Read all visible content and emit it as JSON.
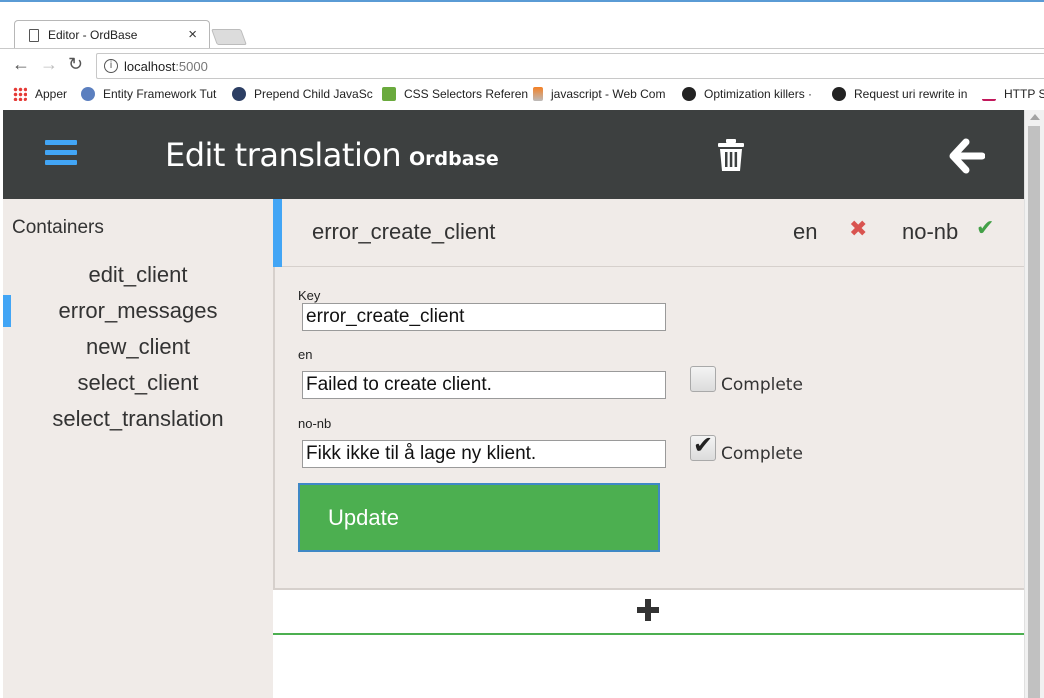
{
  "browser": {
    "tab_title": "Editor - OrdBase",
    "tab_close": "×",
    "url_host": "localhost",
    "url_port": ":5000",
    "bookmarks": [
      {
        "label": "Apper",
        "icon": "apps-grid-icon"
      },
      {
        "label": "Entity Framework Tut",
        "icon": "ef-icon"
      },
      {
        "label": "Prepend Child JavaSc",
        "icon": "x-circle-icon"
      },
      {
        "label": "CSS Selectors Referen",
        "icon": "w3-icon"
      },
      {
        "label": "javascript - Web Com",
        "icon": "stackoverflow-icon"
      },
      {
        "label": "Optimization killers ·",
        "icon": "github-icon"
      },
      {
        "label": "Request uri rewrite in",
        "icon": "github-icon"
      },
      {
        "label": "HTTP S",
        "icon": "http-icon"
      }
    ]
  },
  "header": {
    "title": "Edit translation",
    "subtitle": "Ordbase",
    "colors": {
      "bar": "#3d4040",
      "accent": "#42a5f5"
    }
  },
  "sidebar": {
    "heading": "Containers",
    "items": [
      {
        "label": "edit_client",
        "active": false
      },
      {
        "label": "error_messages",
        "active": true
      },
      {
        "label": "new_client",
        "active": false
      },
      {
        "label": "select_client",
        "active": false
      },
      {
        "label": "select_translation",
        "active": false
      }
    ]
  },
  "entry": {
    "key": "error_create_client",
    "languages": [
      {
        "code": "en",
        "status": "incomplete",
        "status_icon": "x-icon",
        "color": "#d9534f"
      },
      {
        "code": "no-nb",
        "status": "complete",
        "status_icon": "check-icon",
        "color": "#43a047"
      }
    ]
  },
  "form": {
    "key_label": "Key",
    "key_value": "error_create_client",
    "translations": [
      {
        "label": "en",
        "value": "Failed to create client.",
        "complete": false,
        "complete_label": "Complete"
      },
      {
        "label": "no-nb",
        "value": "Fikk ikke til å lage ny klient.",
        "complete": true,
        "complete_label": "Complete"
      }
    ],
    "update_label": "Update",
    "update_color": "#4caf50"
  }
}
